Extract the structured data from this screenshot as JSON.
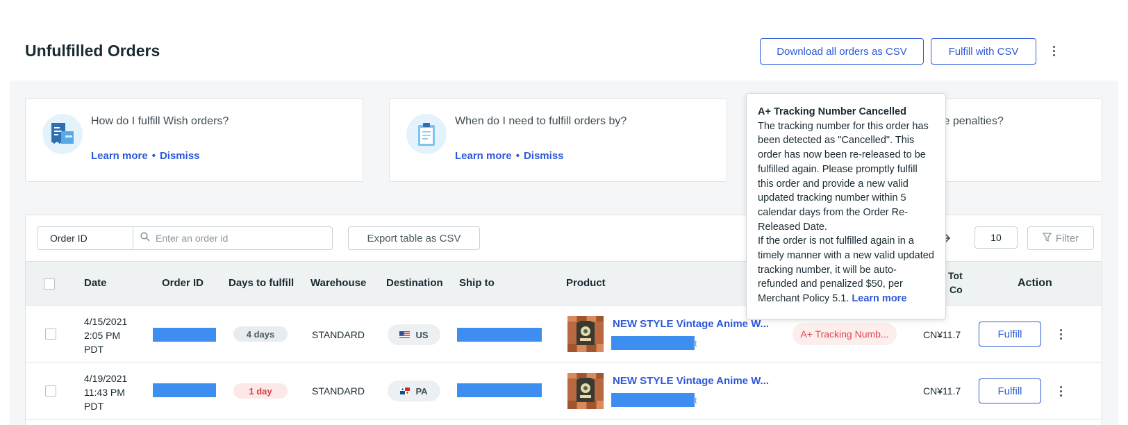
{
  "header": {
    "title": "Unfulfilled Orders",
    "download_label": "Download all orders as CSV",
    "fulfill_csv_label": "Fulfill with CSV"
  },
  "cards": [
    {
      "question": "How do I fulfill Wish orders?",
      "learn_more": "Learn more",
      "dismiss": "Dismiss",
      "icon": "shipping-docs-icon"
    },
    {
      "question": "When do I need to fulfill orders by?",
      "learn_more": "Learn more",
      "dismiss": "Dismiss",
      "icon": "clipboard-icon"
    },
    {
      "question_partial": "ive penalties?"
    }
  ],
  "toolbar": {
    "order_select": "Order ID",
    "search_placeholder": "Enter an order id",
    "export_label": "Export table as CSV",
    "page_size": "10",
    "filter_label": "Filter"
  },
  "table": {
    "headers": {
      "date": "Date",
      "order_id": "Order ID",
      "days": "Days to fulfill",
      "warehouse": "Warehouse",
      "destination": "Destination",
      "ship_to": "Ship to",
      "product": "Product",
      "total_line1": "Tot",
      "total_line2": "Co",
      "action": "Action"
    },
    "rows": [
      {
        "date_line1": "4/15/2021",
        "date_line2": "2:05 PM",
        "date_line3": "PDT",
        "days": "4 days",
        "warehouse": "STANDARD",
        "destination": "US",
        "product": "NEW STYLE Vintage Anime W...",
        "product_sub_tail": "t",
        "status": "A+ Tracking Numb...",
        "total": "CN¥11.7",
        "action": "Fulfill"
      },
      {
        "date_line1": "4/19/2021",
        "date_line2": "11:43 PM",
        "date_line3": "PDT",
        "days": "1 day",
        "warehouse": "STANDARD",
        "destination": "PA",
        "product": "NEW STYLE Vintage Anime W...",
        "product_sub_tail": "t",
        "status": "",
        "total": "CN¥11.7",
        "action": "Fulfill"
      }
    ]
  },
  "tooltip": {
    "title": "A+ Tracking Number Cancelled",
    "body1": "The tracking number for this order has been detected as \"Cancelled\". This order has now been re-released to be fulfilled again. Please promptly fulfill this order and provide a new valid updated tracking number within 5 calendar days from the Order Re-Released Date.",
    "body2": "If the order is not fulfilled again in a timely manner with a new valid updated tracking number, it will be auto-refunded and penalized $50, per Merchant Policy 5.1.",
    "link": "Learn more"
  },
  "colors": {
    "accent": "#2e59d9",
    "redact": "#3d8ef0",
    "warning_bg": "#fdeeee",
    "warning_text": "#e0474c"
  }
}
